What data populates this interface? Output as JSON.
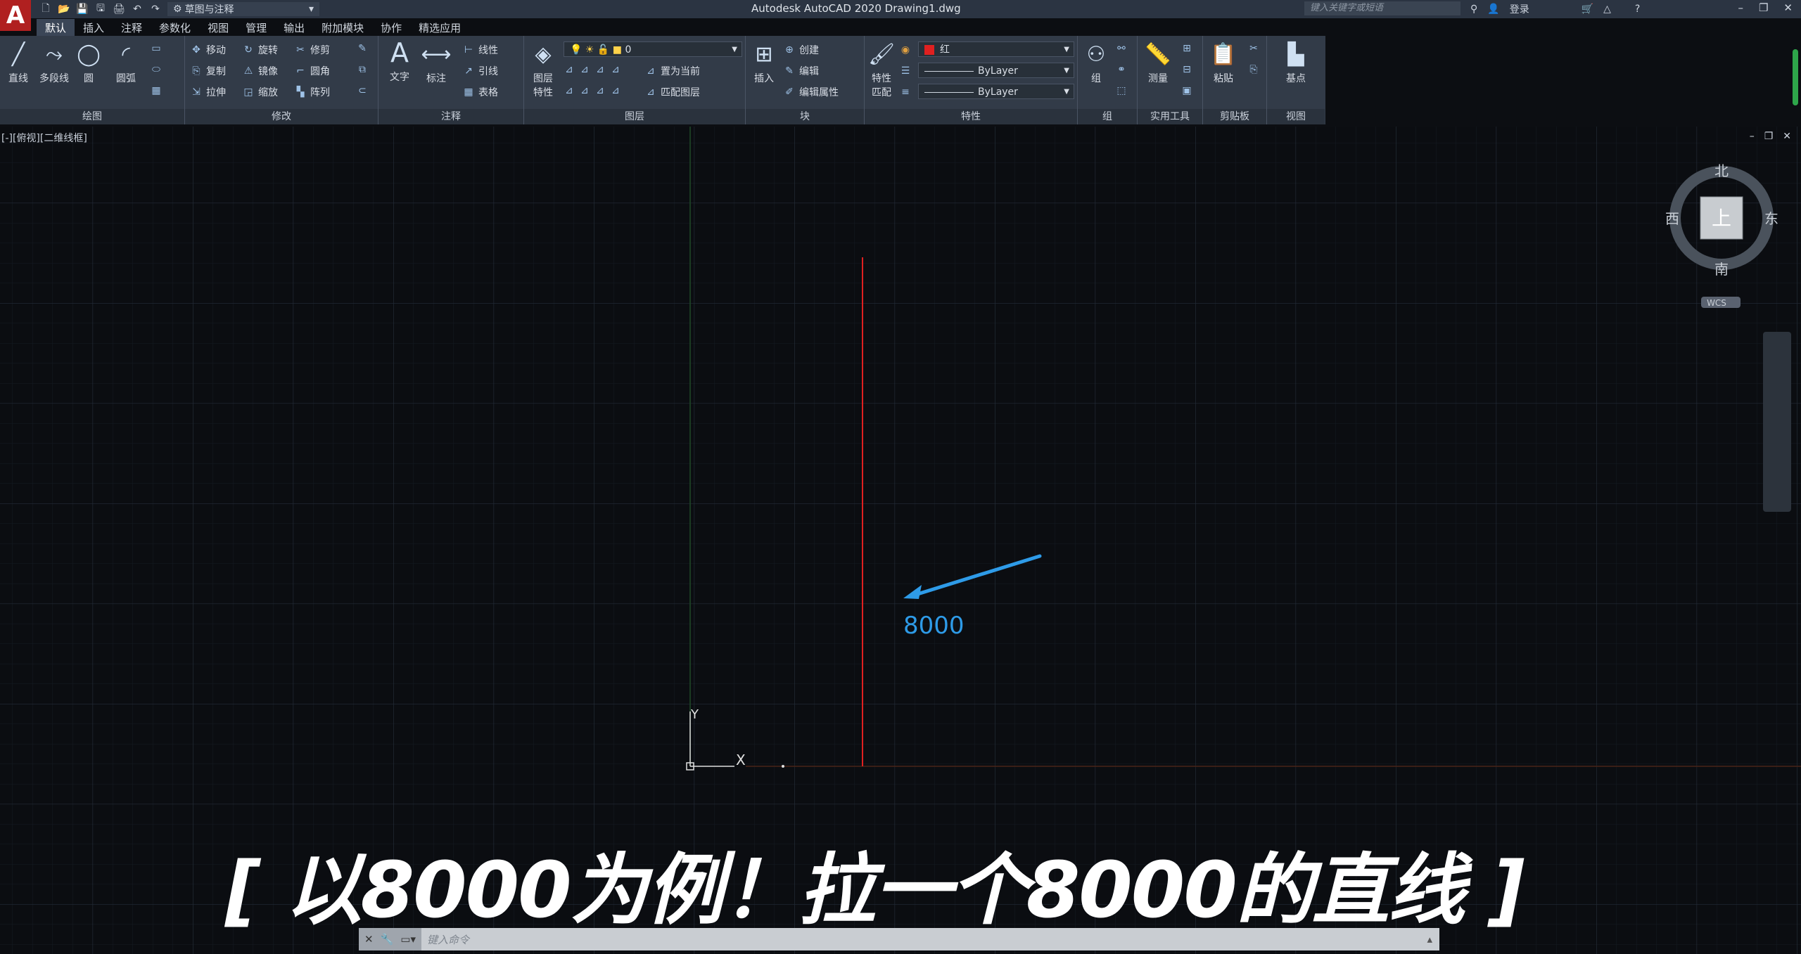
{
  "app": {
    "title": "Autodesk AutoCAD 2020    Drawing1.dwg",
    "logo": "A",
    "workspace": "草图与注释",
    "search_placeholder": "键入关键字或短语",
    "login_label": "登录"
  },
  "tabs": [
    "默认",
    "插入",
    "注释",
    "参数化",
    "视图",
    "管理",
    "输出",
    "附加模块",
    "协作",
    "精选应用"
  ],
  "ribbon": {
    "draw": {
      "title": "绘图",
      "line": "直线",
      "polyline": "多段线",
      "circle": "圆",
      "arc": "圆弧"
    },
    "modify": {
      "title": "修改",
      "move": "移动",
      "rotate": "旋转",
      "trim": "修剪",
      "copy": "复制",
      "mirror": "镜像",
      "fillet": "圆角",
      "stretch": "拉伸",
      "scale": "缩放",
      "array": "阵列"
    },
    "annotation": {
      "title": "注释",
      "text": "文字",
      "dimension": "标注",
      "linear": "线性",
      "leader": "引线",
      "table": "表格"
    },
    "layers": {
      "title": "图层",
      "props_line1": "图层",
      "props_line2": "特性",
      "layer_value": "0",
      "set_current": "置为当前",
      "match_layer": "匹配图层"
    },
    "block": {
      "title": "块",
      "insert": "插入",
      "create": "创建",
      "edit": "编辑",
      "edit_attr": "编辑属性"
    },
    "properties": {
      "title": "特性",
      "match_line1": "特性",
      "match_line2": "匹配",
      "color_value": "红",
      "linetype_value": "ByLayer",
      "lineweight_value": "ByLayer"
    },
    "groups": {
      "title": "组",
      "group": "组"
    },
    "utilities": {
      "title": "实用工具",
      "measure": "测量"
    },
    "clipboard": {
      "title": "剪贴板",
      "paste": "粘贴"
    },
    "view": {
      "title": "视图",
      "base": "基点"
    }
  },
  "viewport": {
    "label": "[-][俯视][二维线框]",
    "compass": {
      "north": "北",
      "south": "南",
      "east": "东",
      "west": "西",
      "top": "上",
      "wcs": "WCS"
    },
    "ucs": {
      "x": "X",
      "y": "Y"
    }
  },
  "annotation_value": "8000",
  "caption": "[ 以8000为例！拉一个8000的直线 ]",
  "command_placeholder": "键入命令",
  "colors": {
    "accent_red": "#e02020",
    "arrow_blue": "#2e9be8",
    "grid": "#1e2530"
  }
}
